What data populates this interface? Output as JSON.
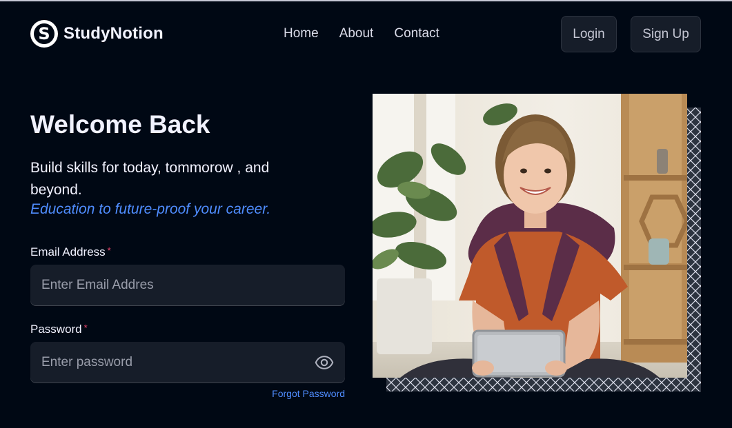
{
  "brand": {
    "logo_letter": "S",
    "name": "StudyNotion"
  },
  "nav": {
    "links": [
      "Home",
      "About",
      "Contact"
    ],
    "login_label": "Login",
    "signup_label": "Sign Up"
  },
  "hero": {
    "title": "Welcome Back",
    "subtitle": "Build skills for today, tommorow , and beyond.",
    "accent": "Education to future-proof your career."
  },
  "form": {
    "email_label": "Email Address",
    "email_placeholder": "Enter Email Addres",
    "password_label": "Password",
    "password_placeholder": "Enter password",
    "required_mark": "*",
    "forgot_label": "Forgot Password"
  },
  "image": {
    "icon": "student-with-tablet-photo",
    "pattern": "cross-hatch-frame"
  },
  "colors": {
    "background": "#000814",
    "accent_blue": "#4f8dff",
    "required_red": "#ef476f",
    "input_bg": "#161d29"
  }
}
